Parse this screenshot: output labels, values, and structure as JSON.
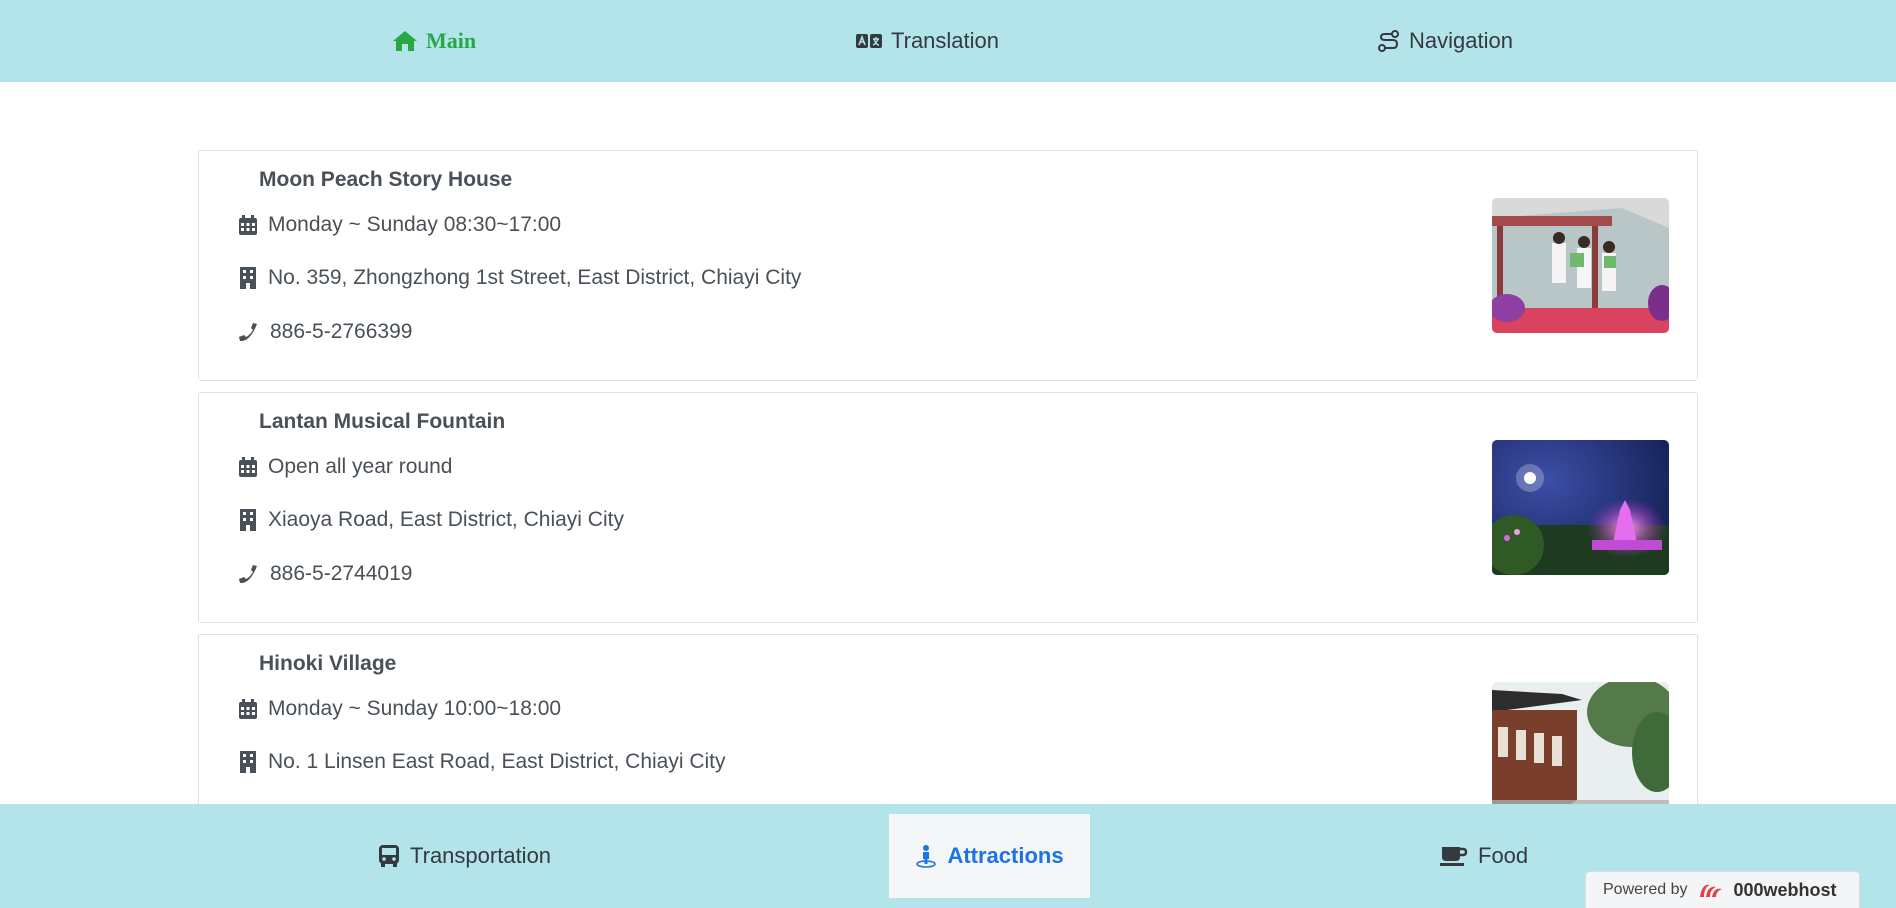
{
  "top_nav": {
    "main": "Main",
    "translation": "Translation",
    "navigation": "Navigation"
  },
  "attractions": [
    {
      "name": "Moon Peach Story House",
      "hours": "Monday ~ Sunday 08:30~17:00",
      "address": "No. 359, Zhongzhong 1st Street, East District, Chiayi City",
      "phone": "886-5-2766399"
    },
    {
      "name": "Lantan Musical Fountain",
      "hours": "Open all year round",
      "address": "Xiaoya Road, East District, Chiayi City",
      "phone": "886-5-2744019"
    },
    {
      "name": "Hinoki Village",
      "hours": "Monday ~ Sunday 10:00~18:00",
      "address": "No. 1 Linsen East Road, East District, Chiayi City",
      "phone": ""
    }
  ],
  "bottom_nav": {
    "transportation": "Transportation",
    "attractions": "Attractions",
    "food": "Food"
  },
  "footer": {
    "powered_by": "Powered by",
    "brand": "000webhost"
  },
  "colors": {
    "nav_bg": "#b2e4ea",
    "active_top": "#28a745",
    "active_bottom": "#1a73e8"
  },
  "icons": [
    "home-icon",
    "translate-icon",
    "route-icon",
    "calendar-icon",
    "building-icon",
    "phone-icon",
    "bus-icon",
    "person-pin-icon",
    "coffee-icon"
  ]
}
